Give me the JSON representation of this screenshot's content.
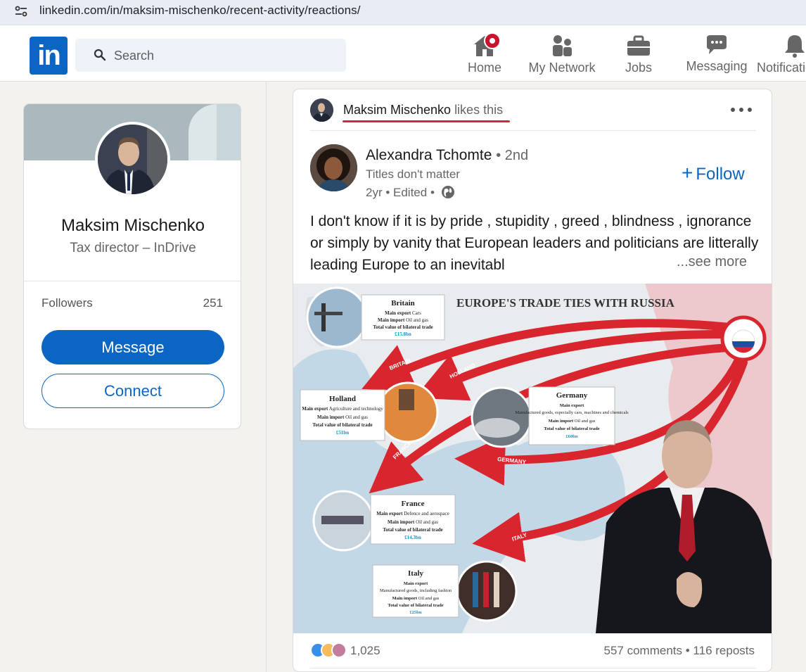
{
  "browser": {
    "url": "linkedin.com/in/maksim-mischenko/recent-activity/reactions/"
  },
  "nav": {
    "logo_text": "in",
    "search_placeholder": "Search",
    "items": [
      {
        "label": "Home",
        "icon": "home-icon"
      },
      {
        "label": "My Network",
        "icon": "network-icon"
      },
      {
        "label": "Jobs",
        "icon": "briefcase-icon"
      },
      {
        "label": "Messaging",
        "icon": "messaging-icon"
      },
      {
        "label": "Notifications",
        "icon": "bell-icon"
      }
    ]
  },
  "profile": {
    "name": "Maksim Mischenko",
    "headline": "Tax director – InDrive",
    "followers_label": "Followers",
    "followers_count": "251",
    "message_label": "Message",
    "connect_label": "Connect"
  },
  "post": {
    "actor_name": "Maksim Mischenko",
    "actor_action": "likes this",
    "author_name": "Alexandra Tchomte",
    "author_degree": "• 2nd",
    "author_headline": "Titles don't matter",
    "author_meta": "2yr • Edited •",
    "follow_label": "Follow",
    "text": "I don't know if it is by pride , stupidity , greed , blindness , ignorance or simply by vanity that European leaders and politicians are litterally leading Europe to an inevitabl",
    "see_more": "...see more",
    "reaction_count": "1,025",
    "comments": "557 comments",
    "reposts": "116 reposts",
    "image": {
      "title": "EUROPE'S TRADE TIES WITH RUSSIA",
      "russia_label": "RUSSIA",
      "arrows": [
        "BRITAIN",
        "HOLLAND",
        "FRANCE",
        "GERMANY",
        "ITALY"
      ],
      "boxes": [
        {
          "country": "Britain",
          "export_label": "Main export",
          "export": "Cars",
          "import_label": "Main import",
          "import": "Oil and gas",
          "total_label": "Total value of bilateral trade",
          "total": "£15.8bn"
        },
        {
          "country": "Holland",
          "export_label": "Main export",
          "export": "Agriculture and technology",
          "import_label": "Main import",
          "import": "Oil and gas",
          "total_label": "Total value of bilateral trade",
          "total": "£51bn"
        },
        {
          "country": "Germany",
          "export_label": "Main export",
          "export": "Manufactured goods, especially cars, machines and chemicals",
          "import_label": "Main import",
          "import": "Oil and gas",
          "total_label": "Total value of bilateral trade",
          "total": "£60bn"
        },
        {
          "country": "France",
          "export_label": "Main export",
          "export": "Defence and aerospace",
          "import_label": "Main import",
          "import": "Oil and gas",
          "total_label": "Total value of bilateral trade",
          "total": "£14.3bn"
        },
        {
          "country": "Italy",
          "export_label": "Main export",
          "export": "Manufactured goods, including fashion",
          "import_label": "Main import",
          "import": "Oil and gas",
          "total_label": "Total value of bilateral trade",
          "total": "£25bn"
        }
      ]
    }
  },
  "colors": {
    "brand": "#0a66c2",
    "arrow_red": "#d9262e",
    "notification_badge": "#cb112d"
  }
}
